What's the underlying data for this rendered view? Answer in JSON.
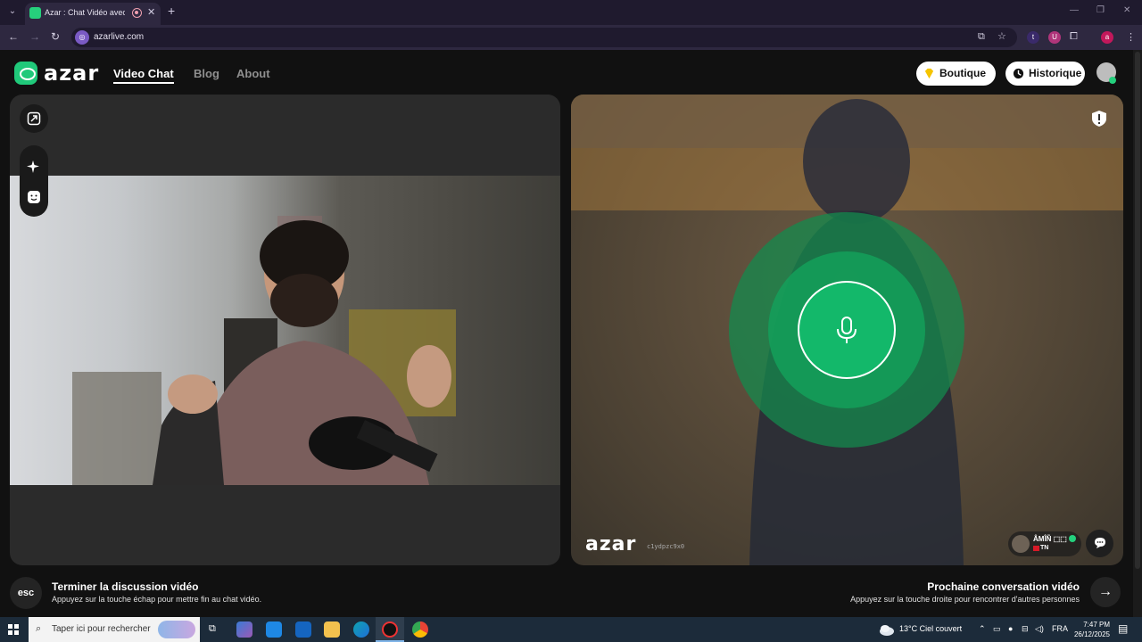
{
  "browser": {
    "tab_title": "Azar : Chat Vidéo avec de n",
    "url": "azarlive.com",
    "site_icon_letter": "◎"
  },
  "header": {
    "logo_text": "azar",
    "nav": [
      {
        "label": "Video Chat",
        "active": true
      },
      {
        "label": "Blog",
        "active": false
      },
      {
        "label": "About",
        "active": false
      }
    ],
    "boutique_label": "Boutique",
    "historique_label": "Historique"
  },
  "remote": {
    "watermark": "azar",
    "code": "c1ydpzc9x0",
    "user_name": "ÂMÎÑ ⬚⬚",
    "country": "TN"
  },
  "bottom": {
    "esc_label": "esc",
    "end_title": "Terminer la discussion vidéo",
    "end_sub": "Appuyez sur la touche échap pour mettre fin au chat vidéo.",
    "next_title": "Prochaine conversation vidéo",
    "next_sub": "Appuyez sur la touche droite pour rencontrer d'autres personnes"
  },
  "taskbar": {
    "search_placeholder": "Taper ici pour rechercher",
    "weather": "13°C  Ciel couvert",
    "language": "FRA",
    "time": "7:47 PM",
    "date": "26/12/2025"
  },
  "colors": {
    "accent_green": "#20c97a",
    "mic_green": "#13b86a",
    "background": "#111111"
  }
}
